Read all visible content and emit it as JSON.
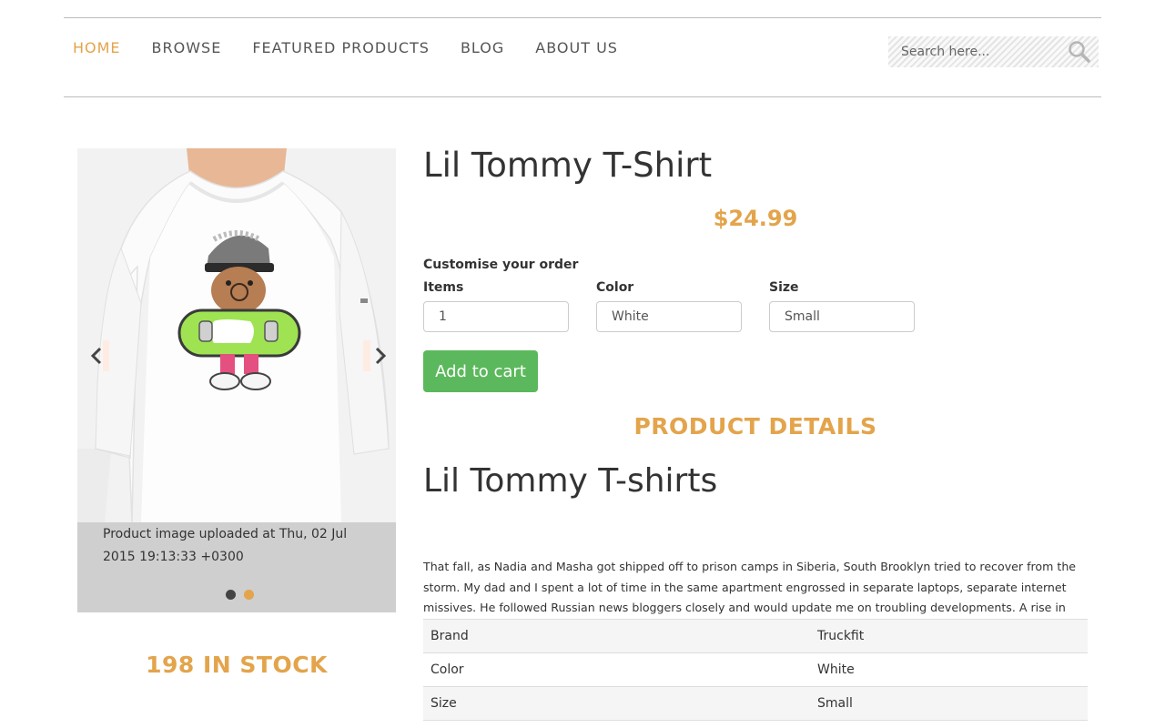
{
  "nav": {
    "items": [
      {
        "label": "HOME",
        "active": true
      },
      {
        "label": "BROWSE",
        "active": false
      },
      {
        "label": "FEATURED PRODUCTS",
        "active": false
      },
      {
        "label": "BLOG",
        "active": false
      },
      {
        "label": "ABOUT US",
        "active": false
      }
    ],
    "search_placeholder": "Search here..."
  },
  "carousel": {
    "caption": "Product image uploaded at Thu, 02 Jul 2015 19:13:33 +0300",
    "slide_count": 2,
    "active_slide": 1,
    "prev_icon": "chevron-left-icon",
    "next_icon": "chevron-right-icon"
  },
  "stock": "198 IN STOCK",
  "product": {
    "title": "Lil Tommy T-Shirt",
    "price": "$24.99",
    "customise_label": "Customise your order",
    "fields": {
      "items": {
        "label": "Items",
        "value": "1"
      },
      "color": {
        "label": "Color",
        "value": "White"
      },
      "size": {
        "label": "Size",
        "value": "Small"
      }
    },
    "add_to_cart": "Add to cart"
  },
  "details": {
    "heading": "PRODUCT DETAILS",
    "subtitle": "Lil Tommy T-shirts",
    "description": "That fall, as Nadia and Masha got shipped off to prison camps in Siberia, South Brooklyn tried to recover from the storm. My dad and I spent a lot of time in the same apartment engrossed in separate laptops, separate internet missives. He followed Russian news bloggers closely and would update me on troubling developments. A rise in protofascist nationalism",
    "specs": [
      {
        "key": "Brand",
        "value": "Truckfit"
      },
      {
        "key": "Color",
        "value": "White"
      },
      {
        "key": "Size",
        "value": "Small"
      }
    ]
  },
  "colors": {
    "accent": "#e3a44b",
    "button": "#5cb85c"
  }
}
